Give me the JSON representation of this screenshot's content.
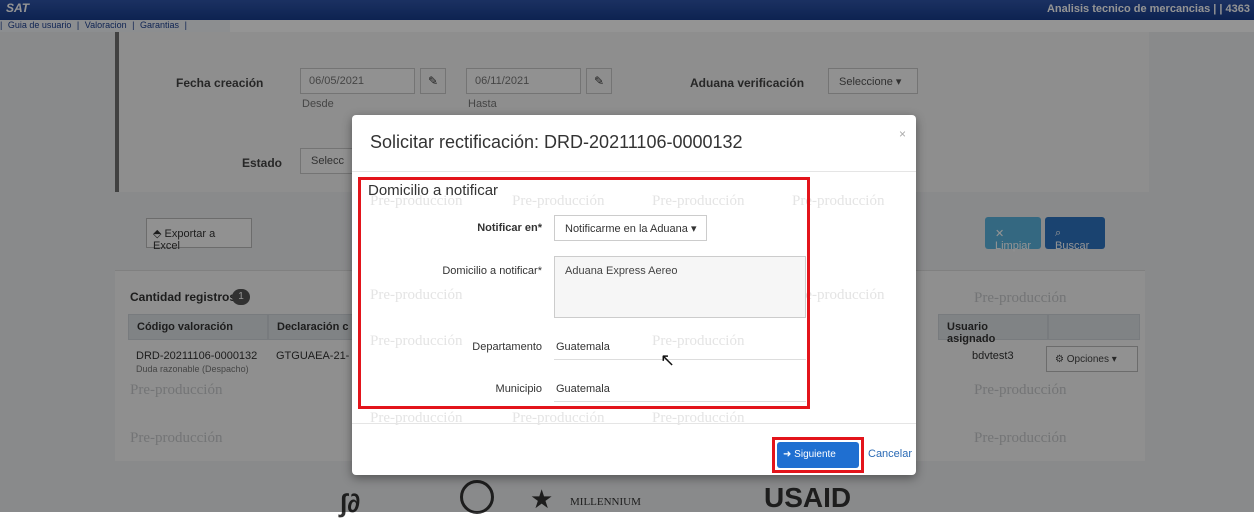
{
  "app": {
    "logo": "SAT",
    "title": "Analisis tecnico de mercancias | | 4363",
    "menu": [
      "Guia de usuario",
      "|",
      "Valoracion",
      "|",
      "Garantias",
      "|"
    ]
  },
  "filters": {
    "fecha_creacion_label": "Fecha creación",
    "desde_value": "06/05/2021",
    "desde_label": "Desde",
    "hasta_value": "06/11/2021",
    "hasta_label": "Hasta",
    "aduana_label": "Aduana verificación",
    "aduana_select": "Seleccione ▾",
    "estado_label": "Estado",
    "estado_select": "Selecc"
  },
  "actions": {
    "export_label": "Exportar a Excel",
    "clear_label": "Limpiar",
    "search_label": "Buscar"
  },
  "results": {
    "count_label": "Cantidad registros",
    "count_value": "1",
    "columns": [
      "Código valoración",
      "Declaración c",
      "Usuario asignado"
    ],
    "row": {
      "codigo": "DRD-20211106-0000132",
      "codigo_sub": "Duda razonable (Despacho)",
      "declaracion": "GTGUAEA-21-",
      "usuario": "bdvtest3",
      "opciones": "Opciones ▾"
    },
    "watermark": "Pre-producción"
  },
  "modal": {
    "title": "Solicitar rectificación: DRD-20211106-0000132",
    "close": "×",
    "section_title": "Domicilio a notificar",
    "notificar_label": "Notificar en*",
    "notificar_value": "Notificarme en la Aduana ▾",
    "domicilio_label": "Domicilio a notificar*",
    "domicilio_value": "Aduana Express Aereo",
    "departamento_label": "Departamento",
    "departamento_value": "Guatemala",
    "municipio_label": "Municipio",
    "municipio_value": "Guatemala",
    "next_label": "Siguiente",
    "cancel_label": "Cancelar"
  },
  "footer": {
    "logo_millennium": "MILLENNIUM",
    "logo_usaid": "USAID"
  },
  "colors": {
    "topbar": "#1f4596",
    "primary_button": "#1f6fd1",
    "highlight": "#e3141b"
  }
}
